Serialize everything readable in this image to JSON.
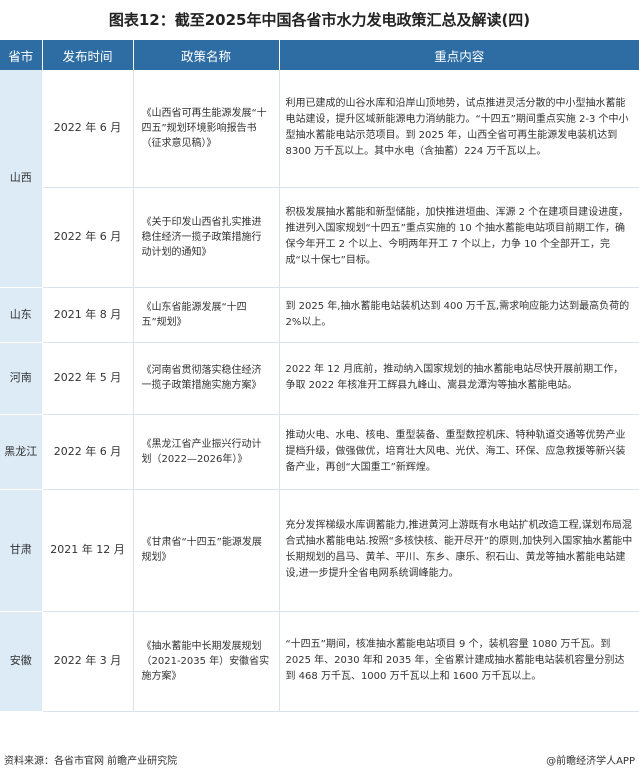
{
  "title": "图表12：截至2025年中国各省市水力发电政策汇总及解读(四)",
  "headers": [
    "省市",
    "发布时间",
    "政策名称",
    "重点内容"
  ],
  "provinces": {
    "shanxi": "山西",
    "shandong": "山东",
    "henan": "河南",
    "heilongjiang": "黑龙江",
    "gansu": "甘肃",
    "anhui": "安徽"
  },
  "rows": [
    {
      "date": "2022 年 6 月",
      "policy": "《山西省可再生能源发展“十四五”规划环境影响报告书（征求意见稿）》",
      "content": "利用已建成的山谷水库和沿岸山顶地势，试点推进灵活分散的中小型抽水蓄能电站建设，提升区域新能源电力消纳能力。“十四五”期间重点实施 2-3 个中小型抽水蓄能电站示范项目。到 2025 年，山西全省可再生能源发电装机达到 8300 万千瓦以上。其中水电（含抽蓄）224 万千瓦以上。"
    },
    {
      "date": "2022 年 6 月",
      "policy": "《关于印发山西省扎实推进稳住经济一揽子政策措施行动计划的通知》",
      "content": "积极发展抽水蓄能和新型储能，加快推进垣曲、浑源 2 个在建项目建设进度，推进列入国家规划“十四五”重点实施的 10 个抽水蓄能电站项目前期工作，确保今年开工 2 个以上、今明两年开工 7 个以上，力争 10 个全部开工，完成“以十保七”目标。"
    },
    {
      "date": "2021 年 8 月",
      "policy": "《山东省能源发展“十四五”规划》",
      "content": "到 2025 年,抽水蓄能电站装机达到 400 万千瓦,需求响应能力达到最高负荷的 2%以上。"
    },
    {
      "date": "2022 年 5 月",
      "policy": "《河南省贯彻落实稳住经济一揽子政策措施实施方案》",
      "content": "2022 年 12 月底前，推动纳入国家规划的抽水蓄能电站尽快开展前期工作，争取 2022 年核准开工辉县九峰山、嵩县龙潭沟等抽水蓄能电站。"
    },
    {
      "date": "2022 年 6 月",
      "policy": "《黑龙江省产业振兴行动计划（2022—2026年）》",
      "content": "推动火电、水电、核电、重型装备、重型数控机床、特种轨道交通等优势产业提档升级，做强做优，培育壮大风电、光伏、海工、环保、应急救援等新兴装备产业，再创“大国重工”新辉煌。"
    },
    {
      "date": "2021 年 12 月",
      "policy": "《甘肃省“十四五”能源发展规划》",
      "content": "充分发挥梯级水库调蓄能力,推进黄河上游既有水电站扩机改造工程,谋划布局混合式抽水蓄能电站.按照“多核快核、能开尽开”的原则,加快列入国家抽水蓄能中长期规划的昌马、黄羊、平川、东乡、康乐、积石山、黄龙等抽水蓄能电站建设,进一步提升全省电网系统调峰能力。"
    },
    {
      "date": "2022 年 3 月",
      "policy": "《抽水蓄能中长期发展规划（2021-2035 年）安徽省实施方案》",
      "content": "“十四五”期间，核准抽水蓄能电站项目 9 个，装机容量 1080 万千瓦。到 2025 年、2030 年和 2035 年，全省累计建成抽水蓄能电站装机容量分别达到 468 万千瓦、1000 万千瓦以上和 1600 万千瓦以上。"
    }
  ],
  "footer": {
    "source": "资料来源：各省市官网 前瞻产业研究院",
    "brand": "@前瞻经济学人APP"
  },
  "colors": {
    "header_bg": "#2e6da4",
    "province_bg": "#ddebf7"
  }
}
